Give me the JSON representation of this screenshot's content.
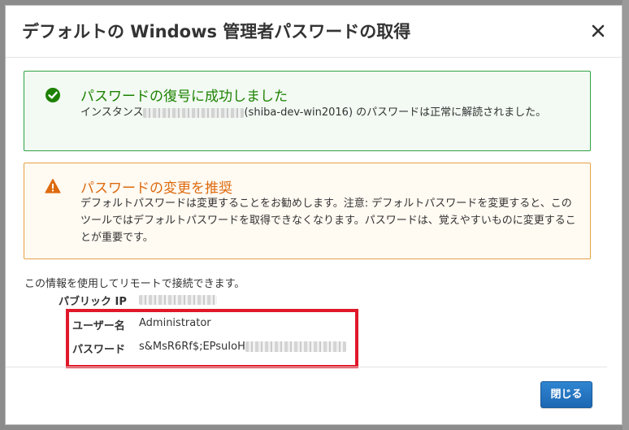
{
  "dialog": {
    "title": "デフォルトの Windows 管理者パスワードの取得",
    "close_icon": "close-icon",
    "success_alert": {
      "icon": "check-circle-icon",
      "heading": "パスワードの復号に成功しました",
      "body_prefix": "インスタンス",
      "body_suffix": "(shiba-dev-win2016) のパスワードは正常に解読されました。",
      "color": "#1d8102"
    },
    "warning_alert": {
      "icon": "warning-triangle-icon",
      "heading": "パスワードの変更を推奨",
      "body": "デフォルトパスワードは変更することをお勧めします。注意: デフォルトパスワードを変更すると、このツールではデフォルトパスワードを取得できなくなります。パスワードは、覚えやすいものに変更することが重要です。",
      "color": "#dd6b10"
    },
    "connection": {
      "intro": "この情報を使用してリモートで接続できます。",
      "public_ip_label": "パブリック IP",
      "username_label": "ユーザー名",
      "username_value": "Administrator",
      "password_label": "パスワード",
      "password_value": "s&MsR6Rf$;EPsuIoH"
    },
    "close_button_label": "閉じる"
  }
}
